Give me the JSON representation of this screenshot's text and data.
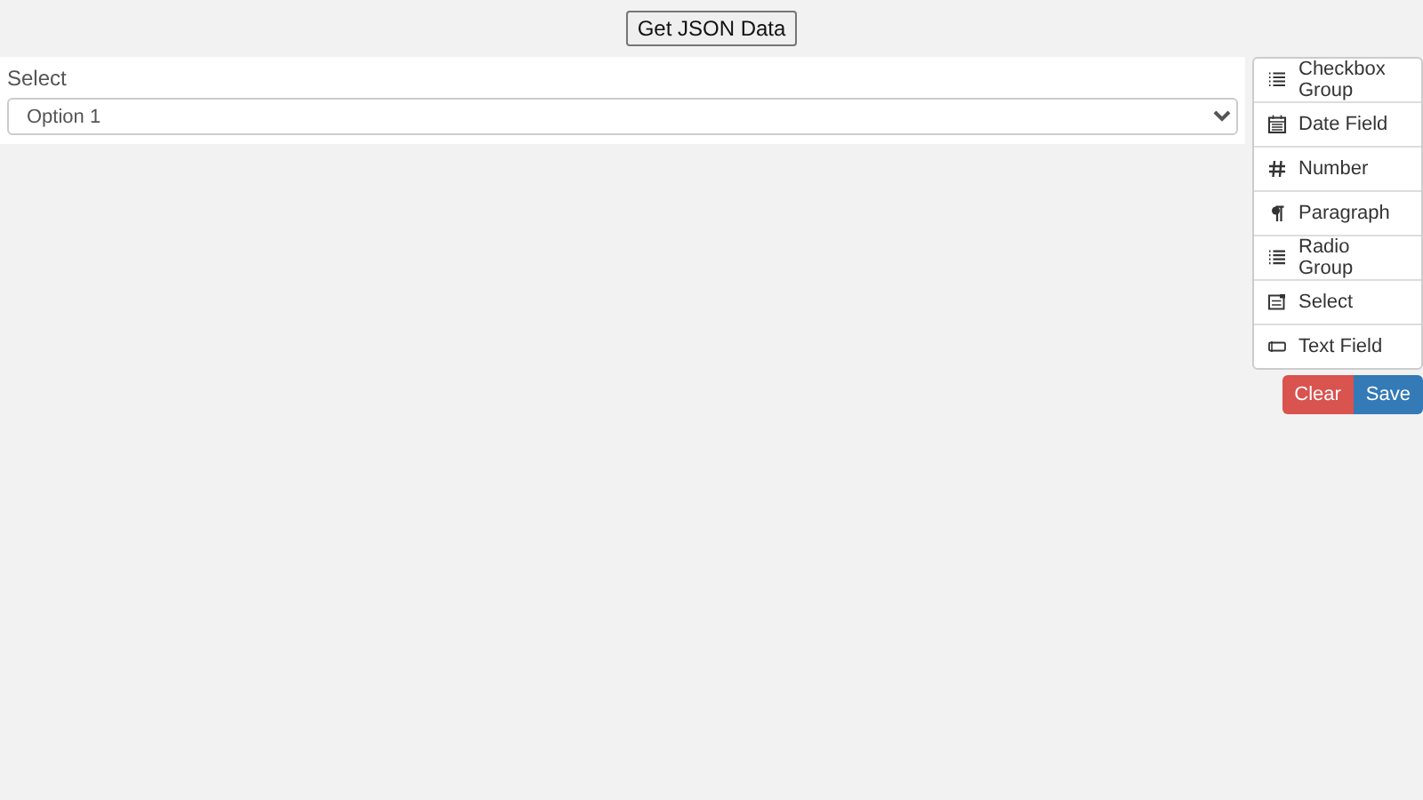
{
  "top_button": "Get JSON Data",
  "stage": {
    "fields": [
      {
        "kind": "select",
        "label": "Select",
        "value": "Option 1"
      }
    ]
  },
  "controls": [
    {
      "kind": "checkbox-group",
      "label": "Checkbox Group"
    },
    {
      "kind": "date",
      "label": "Date Field"
    },
    {
      "kind": "number",
      "label": "Number"
    },
    {
      "kind": "paragraph",
      "label": "Paragraph"
    },
    {
      "kind": "radio-group",
      "label": "Radio Group"
    },
    {
      "kind": "select",
      "label": "Select"
    },
    {
      "kind": "text",
      "label": "Text Field"
    }
  ],
  "actions": [
    {
      "kind": "clear",
      "label": "Clear"
    },
    {
      "kind": "save",
      "label": "Save"
    }
  ]
}
